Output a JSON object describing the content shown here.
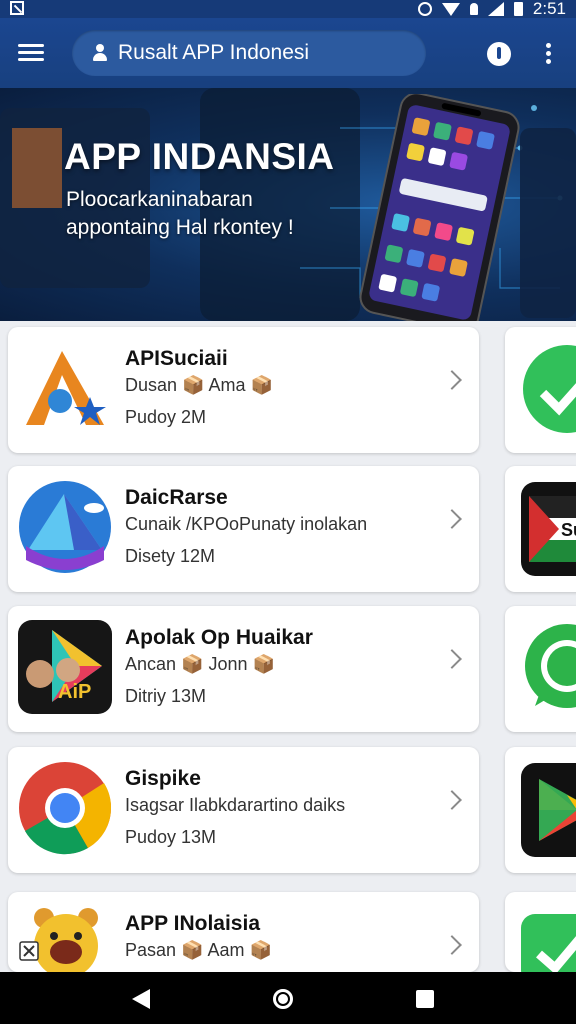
{
  "status_bar": {
    "time": "2:51",
    "icons": [
      "notification-icon",
      "sync-icon",
      "wifi-icon",
      "bell-icon",
      "signal-icon",
      "battery-icon"
    ]
  },
  "app_bar": {
    "title": "Rusalt APP Indonesi",
    "icons": [
      "menu-icon",
      "user-icon",
      "power-icon",
      "more-vert-icon"
    ]
  },
  "hero": {
    "title": "APP INDANSIA",
    "subtitle_line1": "Ploocarkaninabaran",
    "subtitle_line2": "appontaing Hal rkontey !"
  },
  "apps": [
    {
      "title": "APISuciaii",
      "subtitle": "Dusan 📦 Ama 📦",
      "meta": "Pudoy 2M",
      "icon": "arrow-star-icon"
    },
    {
      "title": "DaicRarse",
      "subtitle": "Cunaik /KPOoPunaty inolakan",
      "meta": "Disety 12M",
      "icon": "mountain-icon"
    },
    {
      "title": "Apolak Op Huaikar",
      "subtitle": "Ancan 📦 Jonn 📦",
      "meta": "Ditriy 13M",
      "icon": "play-aip-icon"
    },
    {
      "title": "Gispike",
      "subtitle": "Isagsar Ilabkdarartino daiks",
      "meta": "Pudoy 13M",
      "icon": "chrome-icon"
    },
    {
      "title": "APP INolaisia",
      "subtitle": "Pasan 📦 Aam 📦",
      "meta": "",
      "icon": "bear-mascot-icon"
    }
  ],
  "side_apps": [
    "green-check-icon",
    "flag-app-icon",
    "green-chat-icon",
    "play-store-icon",
    "green-check-icon"
  ],
  "colors": {
    "app_bar": "#1b4690",
    "search_pill": "#2c5a9f",
    "background": "#eceef2"
  }
}
